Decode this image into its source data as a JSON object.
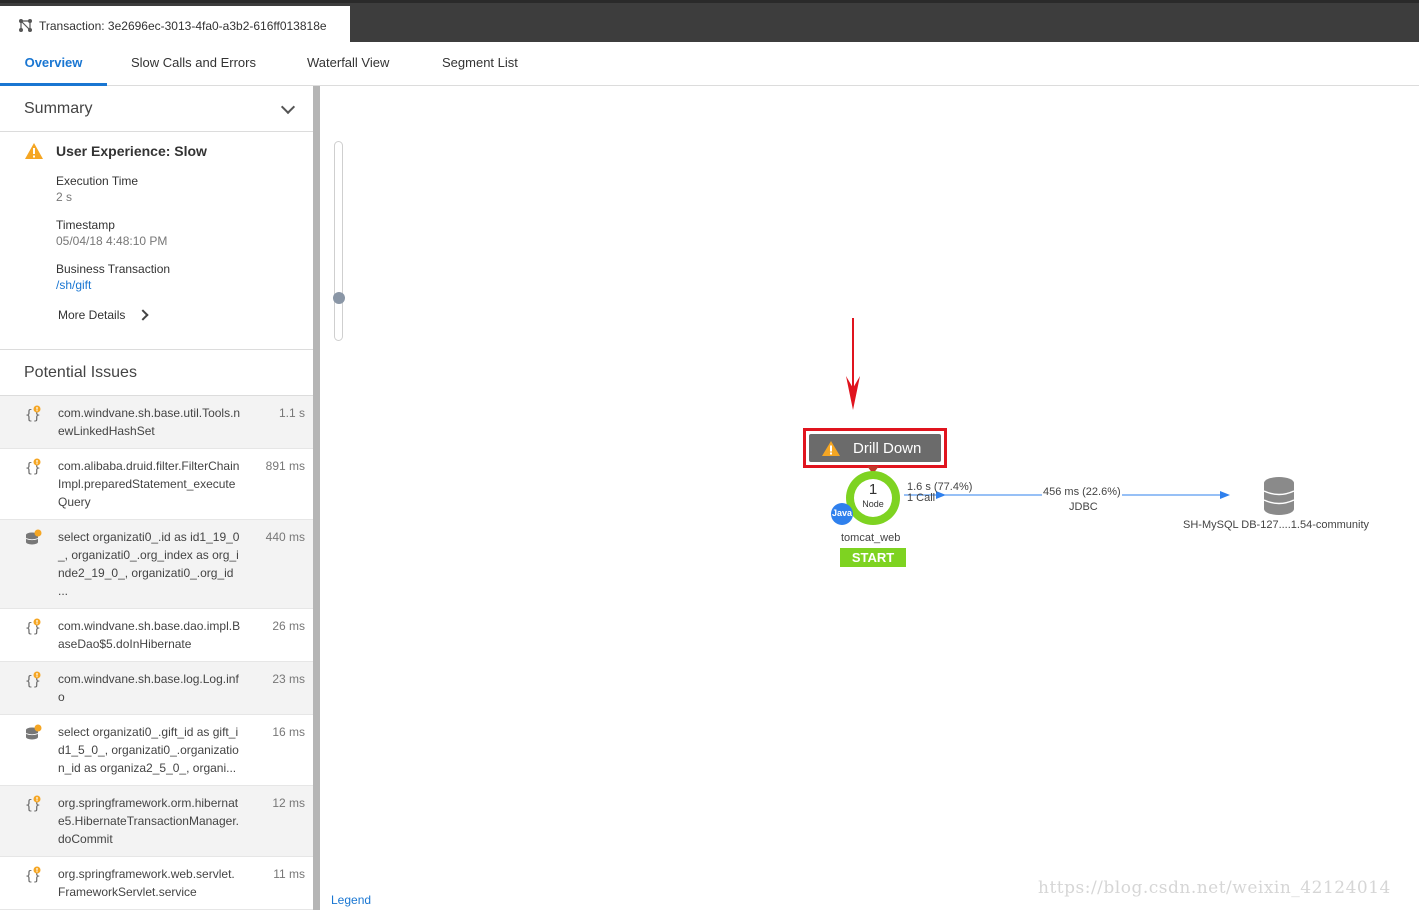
{
  "window": {
    "tab_title": "Transaction: 3e2696ec-3013-4fa0-a3b2-616ff013818e"
  },
  "tabs": [
    {
      "label": "Overview",
      "active": true
    },
    {
      "label": "Slow Calls and Errors",
      "active": false
    },
    {
      "label": "Waterfall View",
      "active": false
    },
    {
      "label": "Segment List",
      "active": false
    }
  ],
  "summary": {
    "heading": "Summary",
    "user_experience": "User Experience: Slow",
    "execution_time_label": "Execution Time",
    "execution_time_value": "2 s",
    "timestamp_label": "Timestamp",
    "timestamp_value": "05/04/18 4:48:10 PM",
    "business_transaction_label": "Business Transaction",
    "business_transaction_value": "/sh/gift",
    "more_details": "More Details"
  },
  "potential_issues": {
    "heading": "Potential Issues",
    "items": [
      {
        "text": "com.windvane.sh.base.util.Tools.newLinkedHashSet",
        "duration": "1.1 s",
        "icon": "code-warning-icon"
      },
      {
        "text": "com.alibaba.druid.filter.FilterChainImpl.preparedStatement_executeQuery",
        "duration": "891 ms",
        "icon": "code-warning-icon"
      },
      {
        "text": "select organizati0_.id as id1_19_0_, organizati0_.org_index as org_inde2_19_0_, organizati0_.org_id ...",
        "duration": "440 ms",
        "icon": "database-warning-icon"
      },
      {
        "text": "com.windvane.sh.base.dao.impl.BaseDao$5.doInHibernate",
        "duration": "26 ms",
        "icon": "code-warning-icon"
      },
      {
        "text": "com.windvane.sh.base.log.Log.info",
        "duration": "23 ms",
        "icon": "code-warning-icon"
      },
      {
        "text": "select organizati0_.gift_id as gift_id1_5_0_, organizati0_.organization_id as organiza2_5_0_, organi...",
        "duration": "16 ms",
        "icon": "database-warning-icon"
      },
      {
        "text": "org.springframework.orm.hibernate5.HibernateTransactionManager.doCommit",
        "duration": "12 ms",
        "icon": "code-warning-icon"
      },
      {
        "text": "org.springframework.web.servlet.FrameworkServlet.service",
        "duration": "11 ms",
        "icon": "code-warning-icon"
      }
    ]
  },
  "flow_map": {
    "drill_down_label": "Drill Down",
    "node_count": "1",
    "node_word": "Node",
    "java_badge": "Java",
    "node_name": "tomcat_web",
    "start_label": "START",
    "call_time": "1.6 s (77.4%)",
    "call_count": "1 Call",
    "db_time": "456 ms (22.6%)",
    "db_type": "JDBC",
    "db_name": "SH-MySQL DB-127....1.54-community",
    "legend": "Legend"
  },
  "watermark": "https://blog.csdn.net/weixin_42124014",
  "colors": {
    "accent": "#1976d2",
    "node_ring": "#7ed321",
    "highlight_box": "#e0141e",
    "warning": "#f5a623"
  }
}
